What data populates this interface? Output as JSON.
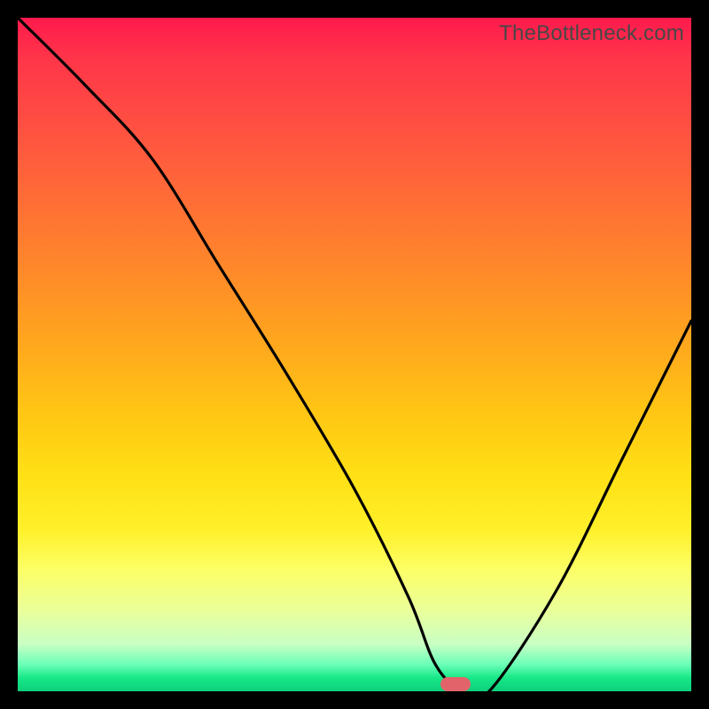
{
  "watermark": "TheBottleneck.com",
  "marker": {
    "x_pct": 65,
    "y_pct": 99
  },
  "chart_data": {
    "type": "line",
    "title": "",
    "xlabel": "",
    "ylabel": "",
    "xlim": [
      0,
      100
    ],
    "ylim": [
      0,
      100
    ],
    "series": [
      {
        "name": "bottleneck-curve",
        "x": [
          0,
          10,
          20,
          30,
          40,
          50,
          58,
          62,
          66,
          70,
          80,
          90,
          100
        ],
        "y": [
          100,
          90,
          79,
          63,
          47,
          30,
          14,
          4,
          0,
          0,
          15,
          35,
          55
        ]
      }
    ],
    "annotations": [
      {
        "name": "optimal-marker",
        "x": 65,
        "y": 0
      }
    ]
  }
}
